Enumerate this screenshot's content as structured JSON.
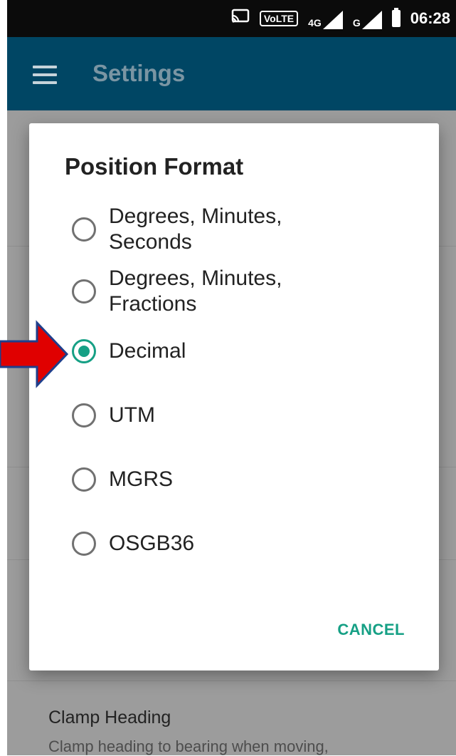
{
  "status_bar": {
    "time": "06:28",
    "volte_label": "VoLTE",
    "network_label": "4G",
    "sim2_label": "G",
    "icons": [
      "cast-icon",
      "volte-icon",
      "4g-signal-icon",
      "g-signal-icon",
      "battery-icon"
    ]
  },
  "app_bar": {
    "title": "Settings",
    "menu_icon": "hamburger-menu-icon"
  },
  "dialog": {
    "title": "Position Format",
    "selected": "Decimal",
    "options": [
      {
        "label": "Degrees, Minutes,\nSeconds"
      },
      {
        "label": "Degrees, Minutes,\nFractions"
      },
      {
        "label": "Decimal"
      },
      {
        "label": "UTM"
      },
      {
        "label": "MGRS"
      },
      {
        "label": "OSGB36"
      }
    ],
    "cancel_label": "CANCEL"
  },
  "background_settings": {
    "clamp_heading_title": "Clamp Heading",
    "clamp_heading_summary": "Clamp heading to bearing when moving,"
  },
  "colors": {
    "appbar": "#004664",
    "accent": "#16a085",
    "arrow_fill": "#e00000",
    "arrow_stroke": "#1f3f8c"
  }
}
